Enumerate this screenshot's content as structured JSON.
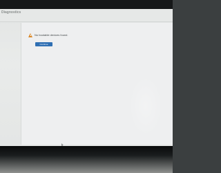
{
  "window": {
    "title": "Diagnostics"
  },
  "alert": {
    "icon": "warning-icon",
    "message": "No bootable devices found.",
    "continue_label": "Continue",
    "accent_color": "#2f6fb3",
    "warning_color": "#d9882a"
  },
  "cursor": {
    "icon": "mouse-pointer-icon"
  }
}
